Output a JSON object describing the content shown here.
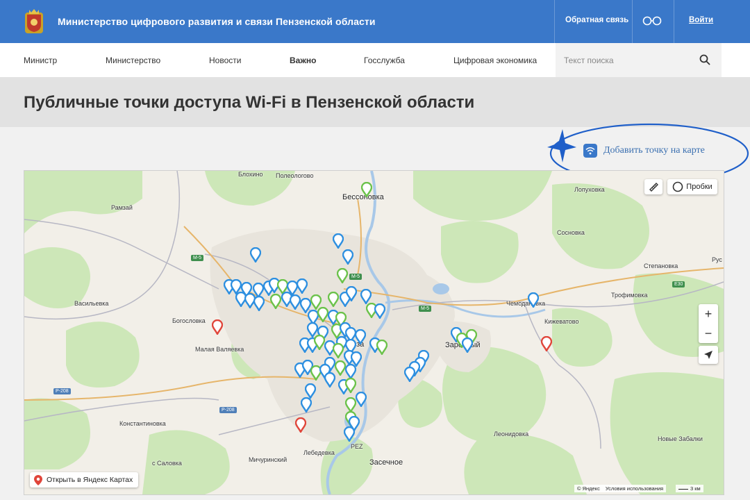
{
  "header": {
    "org_title": "Министерство цифрового развития и связи Пензенской области",
    "feedback": "Обратная связь",
    "login": "Войти",
    "accent_color": "#3a78c9"
  },
  "nav": {
    "items": [
      "Министр",
      "Министерство",
      "Новости",
      "Важно",
      "Госслужба",
      "Цифровая экономика"
    ],
    "active": "Важно",
    "search_placeholder": "Текст поиска"
  },
  "page": {
    "title": "Публичные точки доступа Wi-Fi в Пензенской области",
    "add_point": "Добавить точку на карте"
  },
  "map": {
    "traffic_button": "Пробки",
    "open_in_yandex": "Открыть в Яндекс Картах",
    "copyright": "© Яндекс",
    "terms": "Условия использования",
    "scale": "3 км",
    "zoom_in": "+",
    "zoom_out": "−",
    "places": {
      "blokhino": "Блохино",
      "poleologovo": "Полеологово",
      "bessonovka": "Бессоновка",
      "ramzai": "Рамзай",
      "lopukhovka": "Лопуховка",
      "sosnovka": "Сосновка",
      "stepanovka": "Степановка",
      "rus": "Рус",
      "trofimovka": "Трофимовка",
      "vasilevka": "Васильевка",
      "chemodanovka": "Чемодановка",
      "kizhevatovo": "Кижеватово",
      "bogoslovka": "Богословка",
      "malaya_valyaevka": "Малая Валяевка",
      "konstantinovka": "Константиновка",
      "leonidovka": "Леонидовка",
      "novye_zabalki": "Новые Забалки",
      "salovka": "с Саловка",
      "michurinsky": "Мичуринский",
      "lebedevka": "Лебедевка",
      "zasechnoe": "Засечное",
      "zarechny": "Заречный",
      "penza_partial": "нза",
      "penza_partial2": "нза",
      "pez": "PEZ"
    },
    "roads": {
      "m5_a": "М-5",
      "m5_b": "М-5",
      "m5_c": "М-5",
      "r208_a": "Р-208",
      "r208_b": "Р-208",
      "e30": "E30"
    },
    "marker_colors": {
      "blue": "#2d8fe0",
      "green": "#6bc24a",
      "red": "#e0453a"
    }
  }
}
